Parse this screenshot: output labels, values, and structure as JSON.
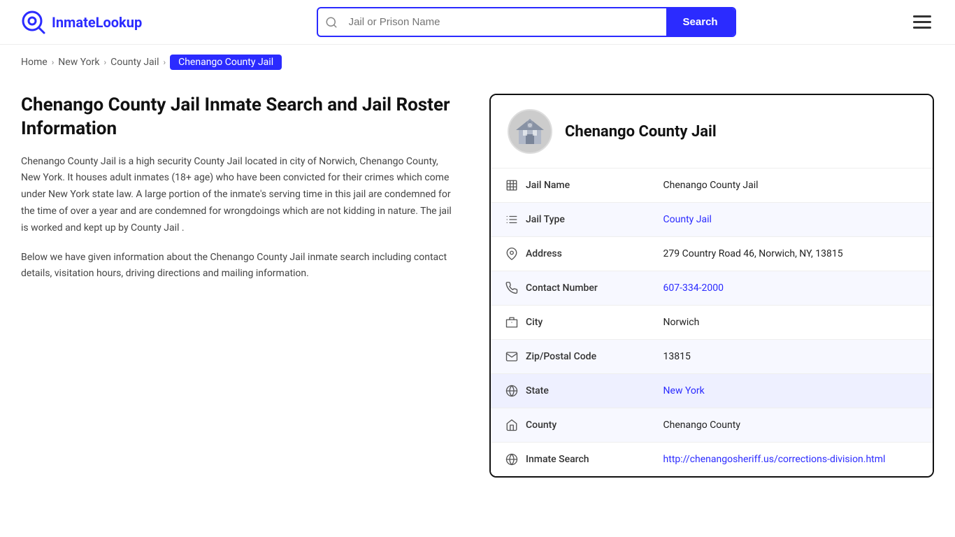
{
  "site": {
    "name": "InmateLookup"
  },
  "header": {
    "search_placeholder": "Jail or Prison Name",
    "search_button_label": "Search"
  },
  "breadcrumb": {
    "home": "Home",
    "state": "New York",
    "category": "County Jail",
    "current": "Chenango County Jail"
  },
  "left": {
    "title": "Chenango County Jail Inmate Search and Jail Roster Information",
    "desc1": "Chenango County Jail is a high security County Jail located in city of Norwich, Chenango County, New York. It houses adult inmates (18+ age) who have been convicted for their crimes which come under New York state law. A large portion of the inmate's serving time in this jail are condemned for the time of over a year and are condemned for wrongdoings which are not kidding in nature. The jail is worked and kept up by County Jail .",
    "desc2": "Below we have given information about the Chenango County Jail inmate search including contact details, visitation hours, driving directions and mailing information."
  },
  "card": {
    "jail_name_heading": "Chenango County Jail",
    "rows": [
      {
        "icon": "building-icon",
        "label": "Jail Name",
        "value": "Chenango County Jail",
        "link": false
      },
      {
        "icon": "list-icon",
        "label": "Jail Type",
        "value": "County Jail",
        "link": true,
        "href": "#"
      },
      {
        "icon": "pin-icon",
        "label": "Address",
        "value": "279 Country Road 46, Norwich, NY, 13815",
        "link": false
      },
      {
        "icon": "phone-icon",
        "label": "Contact Number",
        "value": "607-334-2000",
        "link": true,
        "href": "tel:6073342000"
      },
      {
        "icon": "city-icon",
        "label": "City",
        "value": "Norwich",
        "link": false
      },
      {
        "icon": "mail-icon",
        "label": "Zip/Postal Code",
        "value": "13815",
        "link": false
      },
      {
        "icon": "globe-icon",
        "label": "State",
        "value": "New York",
        "link": true,
        "href": "#",
        "highlight": true
      },
      {
        "icon": "county-icon",
        "label": "County",
        "value": "Chenango County",
        "link": false
      },
      {
        "icon": "search-globe-icon",
        "label": "Inmate Search",
        "value": "http://chenangosheriff.us/corrections-division.html",
        "link": true,
        "href": "http://chenangosheriff.us/corrections-division.html"
      }
    ]
  }
}
